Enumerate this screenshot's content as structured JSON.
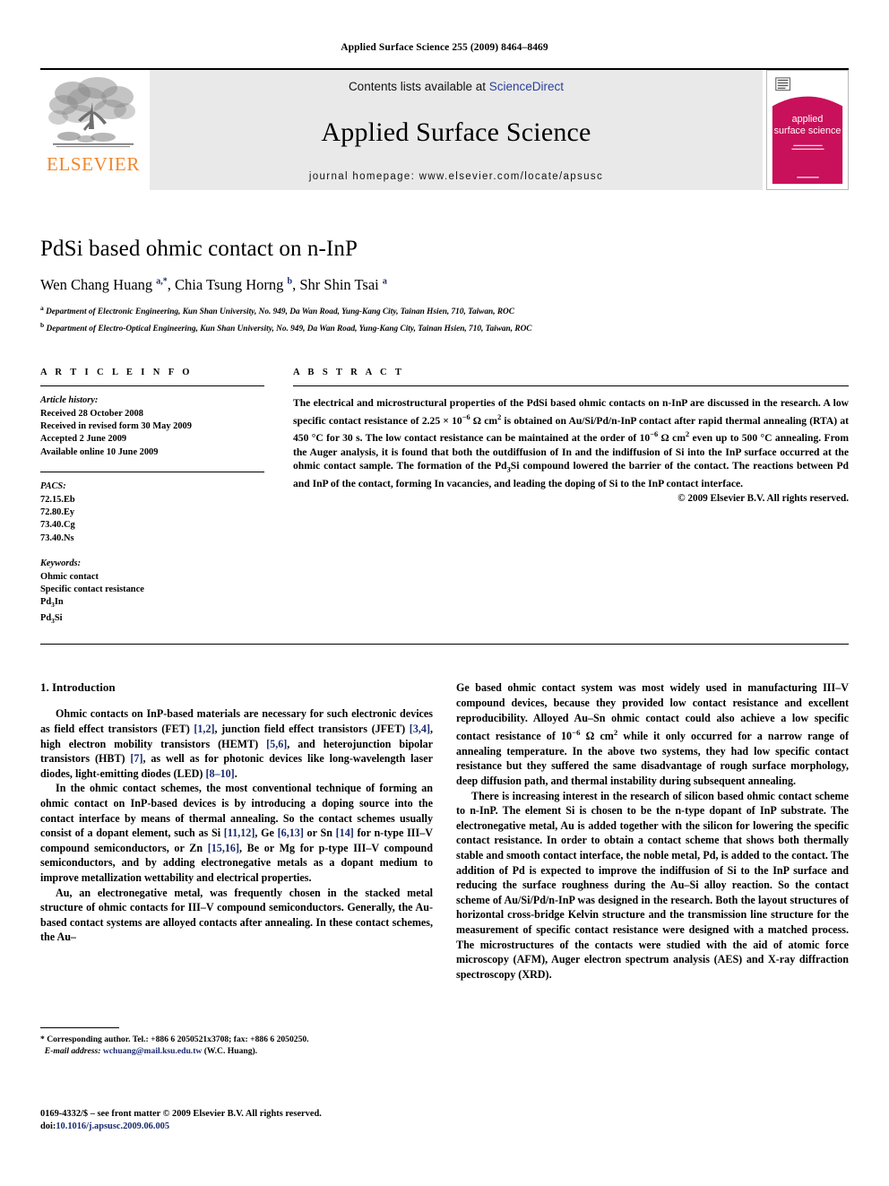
{
  "running_head": "Applied Surface Science 255 (2009) 8464–8469",
  "masthead": {
    "publisher_name": "ELSEVIER",
    "contents_prefix": "Contents lists available at ",
    "contents_link": "ScienceDirect",
    "journal_title": "Applied Surface Science",
    "homepage_line": "journal homepage: www.elsevier.com/locate/apsusc",
    "cover": {
      "line1": "applied",
      "line2": "surface science",
      "accent_color": "#c9105a"
    }
  },
  "article": {
    "title": "PdSi based ohmic contact on n-InP",
    "authors": "Wen Chang Huang a,*, Chia Tsung Horng b, Shr Shin Tsai a",
    "affiliation_a": "Department of Electronic Engineering, Kun Shan University, No. 949, Da Wan Road, Yung-Kang City, Tainan Hsien, 710, Taiwan, ROC",
    "affiliation_b": "Department of Electro-Optical Engineering, Kun Shan University, No. 949, Da Wan Road, Yung-Kang City, Tainan Hsien, 710, Taiwan, ROC"
  },
  "article_info": {
    "heading": "A R T I C L E  I N F O",
    "history_label": "Article history:",
    "history": [
      "Received 28 October 2008",
      "Received in revised form 30 May 2009",
      "Accepted 2 June 2009",
      "Available online 10 June 2009"
    ],
    "pacs_label": "PACS:",
    "pacs": [
      "72.15.Eb",
      "72.80.Ey",
      "73.40.Cg",
      "73.40.Ns"
    ],
    "keywords_label": "Keywords:",
    "keywords": [
      "Ohmic contact",
      "Specific contact resistance",
      "Pd3In",
      "Pd3Si"
    ]
  },
  "abstract": {
    "heading": "A B S T R A C T",
    "text": "The electrical and microstructural properties of the PdSi based ohmic contacts on n-InP are discussed in the research. A low specific contact resistance of 2.25 × 10−6 Ω cm2 is obtained on Au/Si/Pd/n-InP contact after rapid thermal annealing (RTA) at 450 °C for 30 s. The low contact resistance can be maintained at the order of 10−6 Ω cm2 even up to 500 °C annealing. From the Auger analysis, it is found that both the outdiffusion of In and the indiffusion of Si into the InP surface occurred at the ohmic contact sample. The formation of the Pd3Si compound lowered the barrier of the contact. The reactions between Pd and InP of the contact, forming In vacancies, and leading the doping of Si to the InP contact interface.",
    "copyright": "© 2009 Elsevier B.V. All rights reserved."
  },
  "introduction": {
    "section_number_title": "1. Introduction",
    "left_paragraphs": [
      "Ohmic contacts on InP-based materials are necessary for such electronic devices as field effect transistors (FET) [1,2], junction field effect transistors (JFET) [3,4], high electron mobility transistors (HEMT) [5,6], and heterojunction bipolar transistors (HBT) [7], as well as for photonic devices like long-wavelength laser diodes, light-emitting diodes (LED) [8–10].",
      "In the ohmic contact schemes, the most conventional technique of forming an ohmic contact on InP-based devices is by introducing a doping source into the contact interface by means of thermal annealing. So the contact schemes usually consist of a dopant element, such as Si [11,12], Ge [6,13] or Sn [14] for n-type III–V compound semiconductors, or Zn [15,16], Be or Mg for p-type III–V compound semiconductors, and by adding electronegative metals as a dopant medium to improve metallization wettability and electrical properties.",
      "Au, an electronegative metal, was frequently chosen in the stacked metal structure of ohmic contacts for III–V compound semiconductors. Generally, the Au-based contact systems are alloyed contacts after annealing. In these contact schemes, the Au–"
    ],
    "right_paragraphs": [
      "Ge based ohmic contact system was most widely used in manufacturing III–V compound devices, because they provided low contact resistance and excellent reproducibility. Alloyed Au–Sn ohmic contact could also achieve a low specific contact resistance of 10−6 Ω cm2 while it only occurred for a narrow range of annealing temperature. In the above two systems, they had low specific contact resistance but they suffered the same disadvantage of rough surface morphology, deep diffusion path, and thermal instability during subsequent annealing.",
      "There is increasing interest in the research of silicon based ohmic contact scheme to n-InP. The element Si is chosen to be the n-type dopant of InP substrate. The electronegative metal, Au is added together with the silicon for lowering the specific contact resistance. In order to obtain a contact scheme that shows both thermally stable and smooth contact interface, the noble metal, Pd, is added to the contact. The addition of Pd is expected to improve the indiffusion of Si to the InP surface and reducing the surface roughness during the Au–Si alloy reaction. So the contact scheme of Au/Si/Pd/n-InP was designed in the research. Both the layout structures of horizontal cross-bridge Kelvin structure and the transmission line structure for the measurement of specific contact resistance were designed with a matched process. The microstructures of the contacts were studied with the aid of atomic force microscopy (AFM), Auger electron spectrum analysis (AES) and X-ray diffraction spectroscopy (XRD)."
    ]
  },
  "footnote": {
    "corresponding": "* Corresponding author. Tel.: +886 6 2050521x3708; fax: +886 6 2050250.",
    "email_label": "E-mail address:",
    "email": "wchuang@mail.ksu.edu.tw",
    "email_suffix": "(W.C. Huang)."
  },
  "footer": {
    "issn_line": "0169-4332/$ – see front matter © 2009 Elsevier B.V. All rights reserved.",
    "doi_label": "doi:",
    "doi": "10.1016/j.apsusc.2009.06.005"
  }
}
